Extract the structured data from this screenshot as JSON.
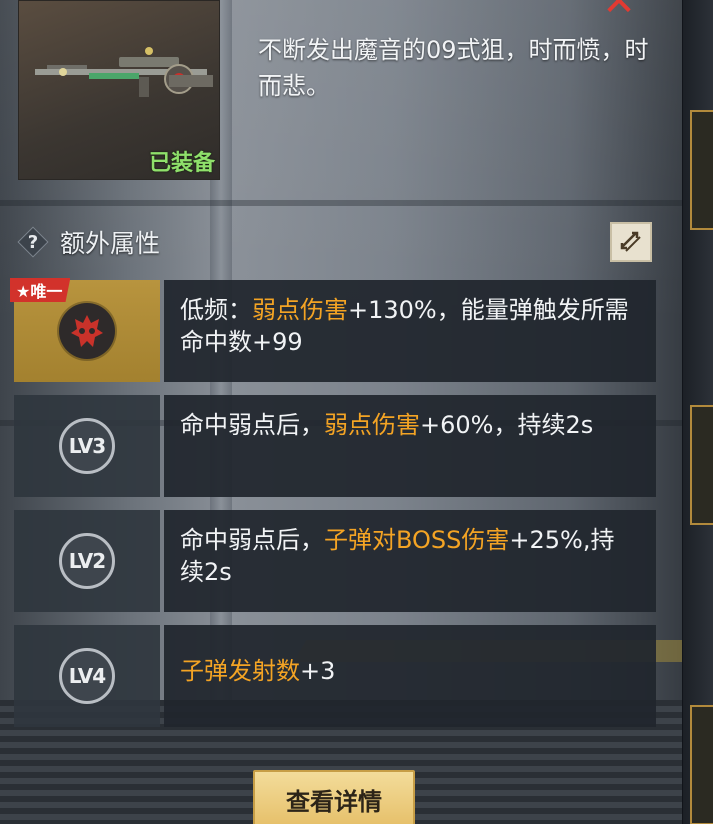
{
  "weapon": {
    "equipped_label": "已装备",
    "description": "不断发出魔音的09式狙，时而愤，时而悲。"
  },
  "close_button": "✕",
  "section": {
    "help_icon": "?",
    "title": "额外属性"
  },
  "attributes": [
    {
      "badge": "★唯一",
      "icon": "demon-mask-icon",
      "prefix": "低频：",
      "highlight": "弱点伤害",
      "suffix": "+130%，能量弹触发所需命中数+99"
    },
    {
      "level": "LV3",
      "prefix": "命中弱点后，",
      "highlight": "弱点伤害",
      "suffix": "+60%，持续2s"
    },
    {
      "level": "LV2",
      "prefix": "命中弱点后，",
      "highlight": "子弹对BOSS伤害",
      "suffix": "+25%,持续2s"
    },
    {
      "level": "LV4",
      "prefix": "",
      "highlight": "子弹发射数",
      "suffix": "+3"
    }
  ],
  "detail_button": "查看详情",
  "colors": {
    "highlight": "#f4a424",
    "equipped": "#8fe06b",
    "unique_badge": "#d2322b",
    "unique_row": "#b8943e",
    "close": "#e23a32"
  }
}
